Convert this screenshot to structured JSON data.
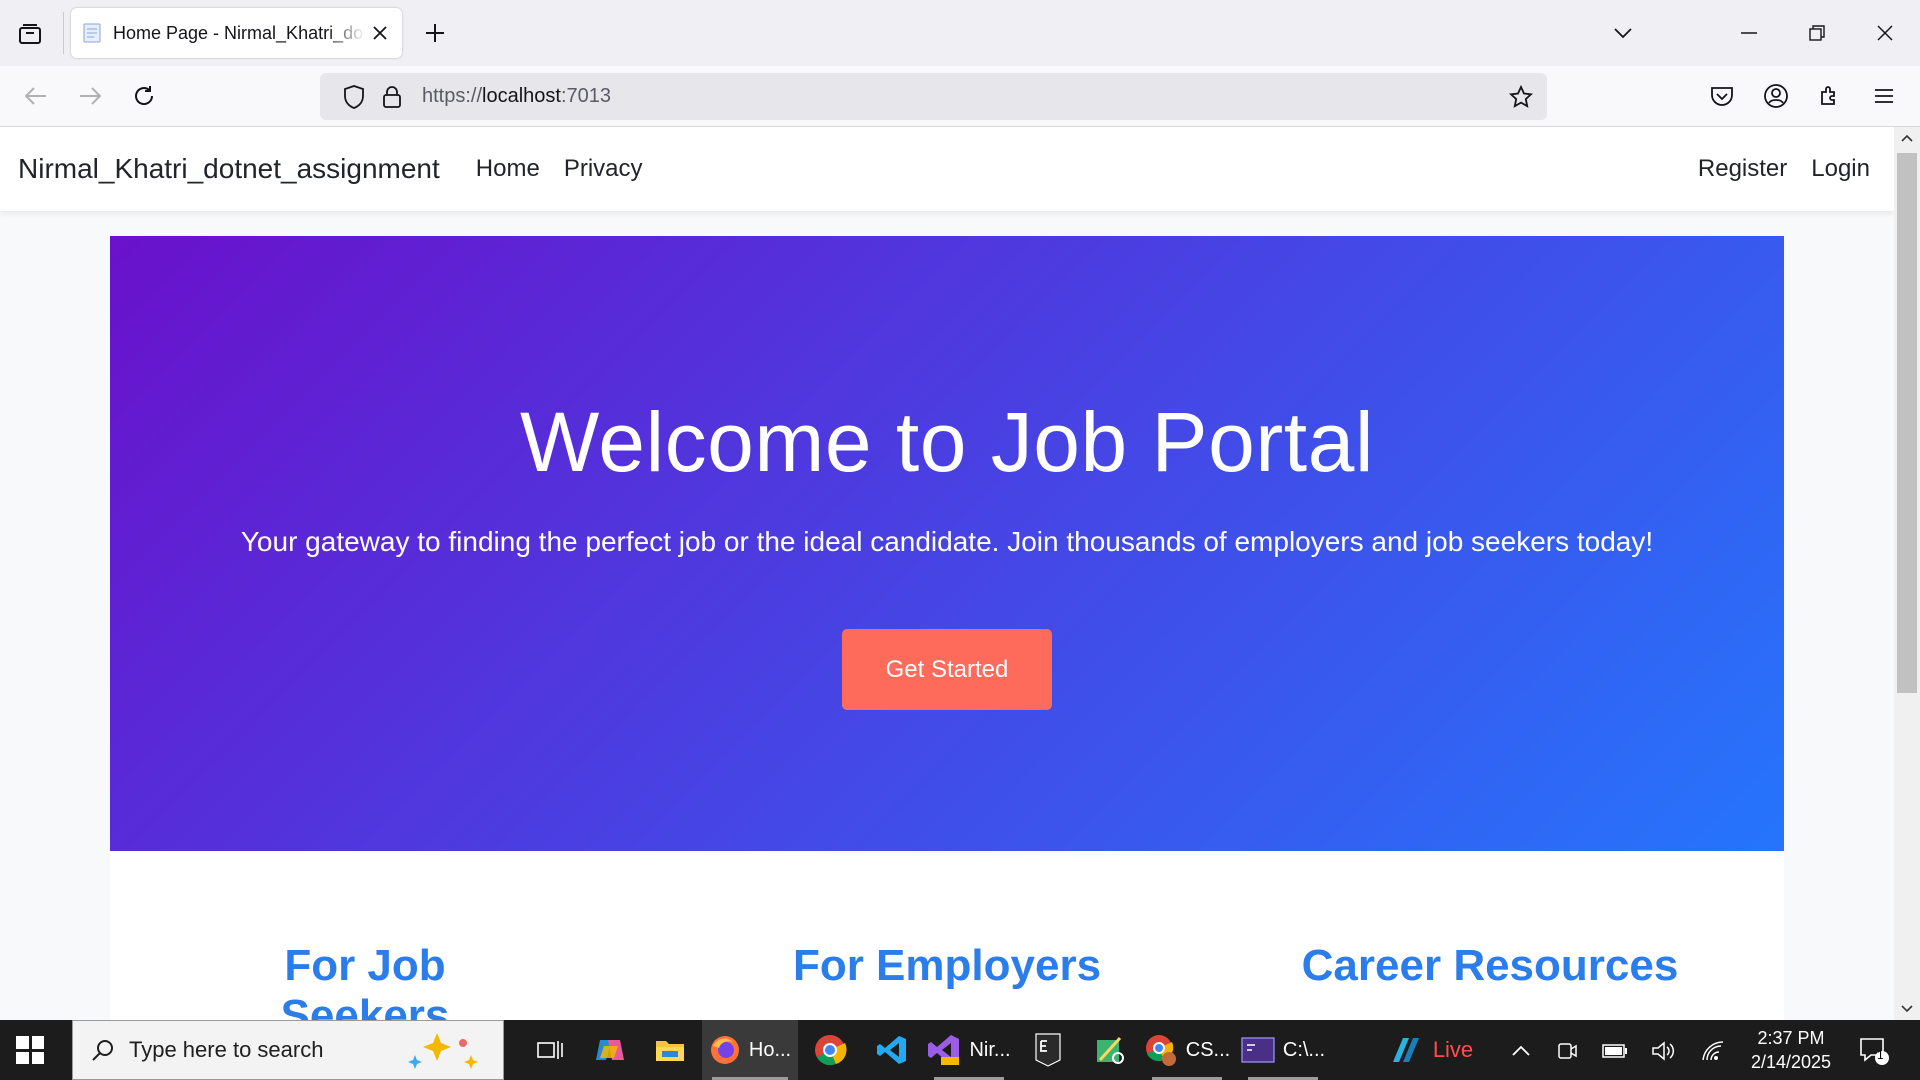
{
  "browser": {
    "tab_title": "Home Page - Nirmal_Khatri_dotnet_assignment",
    "url_prefix": "https://",
    "url_host": "localhost",
    "url_suffix": ":7013"
  },
  "site": {
    "brand": "Nirmal_Khatri_dotnet_assignment",
    "nav_left": [
      "Home",
      "Privacy"
    ],
    "nav_right": [
      "Register",
      "Login"
    ]
  },
  "hero": {
    "title": "Welcome to Job Portal",
    "subtitle": "Your gateway to finding the perfect job or the ideal candidate. Join thousands of employers and job seekers today!",
    "button": "Get Started",
    "gradient_start": "#6a11cb",
    "gradient_end": "#2575fc",
    "button_color": "#ff6b5a"
  },
  "features": {
    "items": [
      "For Job Seekers",
      "For Employers",
      "Career Resources"
    ],
    "color": "#2b7de9"
  },
  "taskbar": {
    "search_placeholder": "Type here to search",
    "firefox_label": "Ho...",
    "vs_label": "Nir...",
    "chrome_label": "CS...",
    "terminal_label": "C:\\...",
    "live_label": "Live",
    "time": "2:37 PM",
    "date": "2/14/2025",
    "notification_count": "1"
  }
}
